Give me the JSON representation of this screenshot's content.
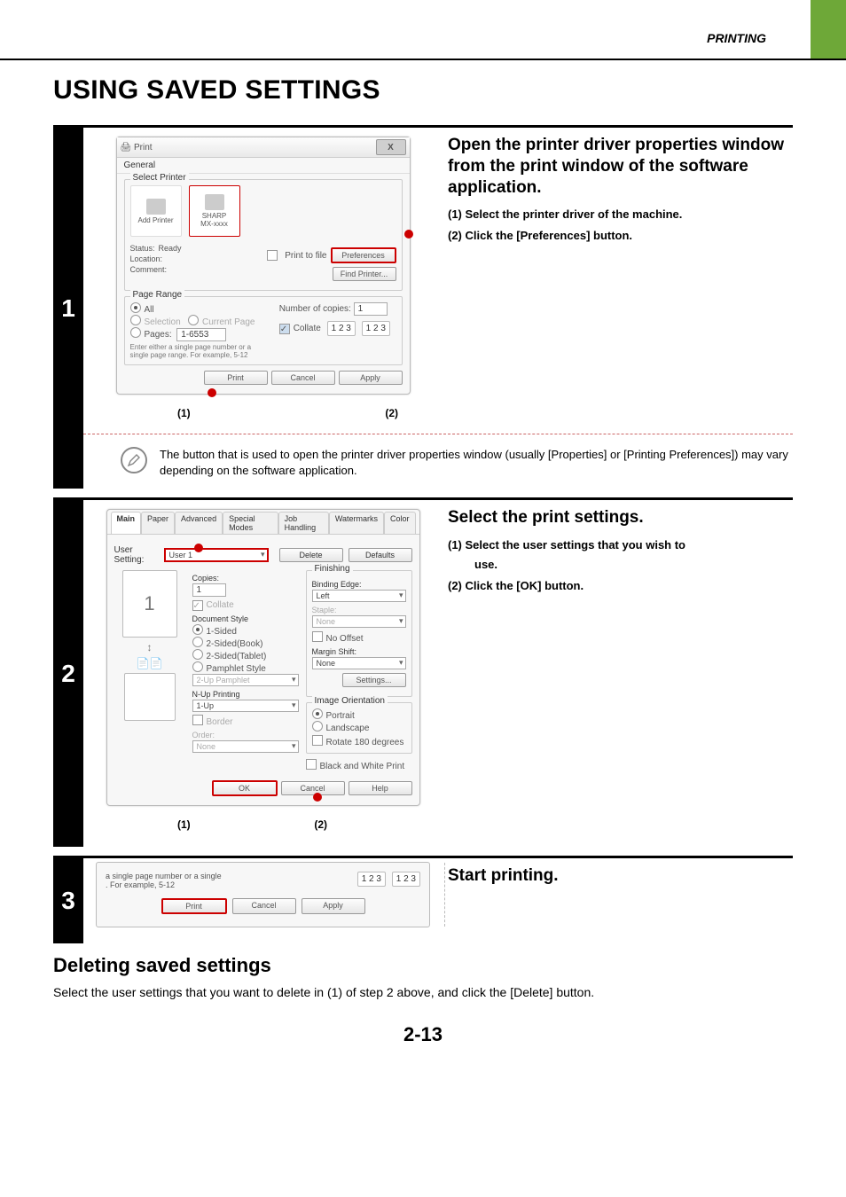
{
  "header": {
    "section": "PRINTING"
  },
  "page_title": "USING SAVED SETTINGS",
  "step1": {
    "num": "1",
    "title": "Open the printer driver properties window from the print window of the software application.",
    "lines": [
      "(1)  Select the printer driver of the machine.",
      "(2)  Click the [Preferences] button."
    ],
    "labels": {
      "a": "(1)",
      "b": "(2)"
    },
    "dialog": {
      "title": "Print",
      "tab": "General",
      "select_printer": "Select Printer",
      "add_printer": "Add Printer",
      "sharp": "SHARP",
      "sharp_sub": "MX-xxxx",
      "status_lbl": "Status:",
      "status_val": "Ready",
      "location_lbl": "Location:",
      "comment_lbl": "Comment:",
      "print_to_file": "Print to file",
      "preferences": "Preferences",
      "find_printer": "Find Printer...",
      "page_range": "Page Range",
      "pr_all": "All",
      "pr_sel": "Selection",
      "pr_cur": "Current Page",
      "pr_pages": "Pages:",
      "pages_val": "1-6553",
      "pr_help": "Enter either a single page number or a single page range.  For example, 5-12",
      "copies_lbl": "Number of copies:",
      "copies_val": "1",
      "collate": "Collate",
      "collate_icon": "1 2 3",
      "btn_print": "Print",
      "btn_cancel": "Cancel",
      "btn_apply": "Apply",
      "close": "X"
    },
    "note": "The button that is used to open the printer driver properties window (usually [Properties] or [Printing Preferences]) may vary depending on the software application."
  },
  "step2": {
    "num": "2",
    "title": "Select the print settings.",
    "lines": [
      "(1)  Select the user settings that you wish to",
      "(2)  Click the [OK] button."
    ],
    "line1_cont": "use.",
    "labels": {
      "a": "(1)",
      "b": "(2)"
    },
    "dialog": {
      "tabs": [
        "Main",
        "Paper",
        "Advanced",
        "Special Modes",
        "Job Handling",
        "Watermarks",
        "Color"
      ],
      "user_setting_lbl": "User Setting:",
      "user_setting_val": "User 1",
      "btn_delete": "Delete",
      "btn_defaults": "Defaults",
      "copies_lbl": "Copies:",
      "copies_val": "1",
      "collate": "Collate",
      "doc_style": "Document Style",
      "ds_1": "1-Sided",
      "ds_2": "2-Sided(Book)",
      "ds_3": "2-Sided(Tablet)",
      "ds_4": "Pamphlet Style",
      "pamphlet_val": "2-Up Pamphlet",
      "nup_lbl": "N-Up Printing",
      "nup_val": "1-Up",
      "border": "Border",
      "order_lbl": "Order:",
      "order_val": "None",
      "finishing": "Finishing",
      "bind_lbl": "Binding Edge:",
      "bind_val": "Left",
      "staple_lbl": "Staple:",
      "staple_val": "None",
      "no_offset": "No Offset",
      "margin_lbl": "Margin Shift:",
      "margin_val": "None",
      "btn_settings": "Settings...",
      "orient": "Image Orientation",
      "orient_p": "Portrait",
      "orient_l": "Landscape",
      "rotate": "Rotate 180 degrees",
      "bw": "Black and White Print",
      "btn_ok": "OK",
      "btn_cancel": "Cancel",
      "btn_help": "Help",
      "thumb_num": "1"
    }
  },
  "step3": {
    "num": "3",
    "title": "Start printing.",
    "panel": {
      "text_hint": "a single page number or a single\n.  For example, 5-12",
      "collate_icon": "1 2 3",
      "btn_print": "Print",
      "btn_cancel": "Cancel",
      "btn_apply": "Apply"
    }
  },
  "deleting": {
    "heading": "Deleting saved settings",
    "text": "Select the user settings that you want to delete in (1) of step 2 above, and click the [Delete] button."
  },
  "page_num": "2-13"
}
